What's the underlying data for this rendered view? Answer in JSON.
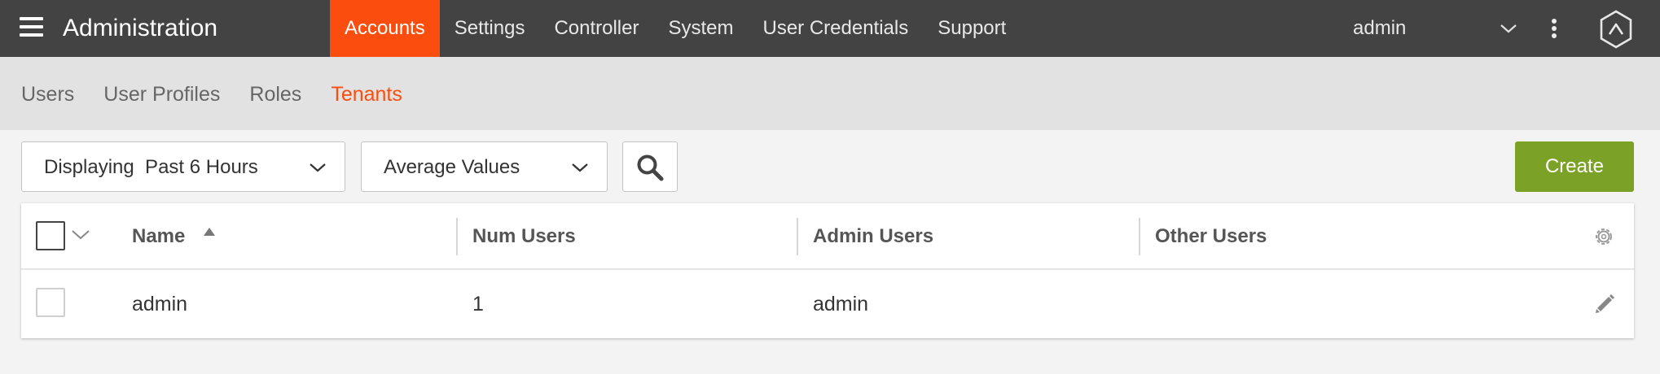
{
  "app": {
    "title": "Administration"
  },
  "top_nav": [
    {
      "label": "Accounts",
      "active": true
    },
    {
      "label": "Settings",
      "active": false
    },
    {
      "label": "Controller",
      "active": false
    },
    {
      "label": "System",
      "active": false
    },
    {
      "label": "User Credentials",
      "active": false
    },
    {
      "label": "Support",
      "active": false
    }
  ],
  "user": {
    "name": "admin"
  },
  "sub_nav": [
    {
      "label": "Users",
      "active": false
    },
    {
      "label": "User Profiles",
      "active": false
    },
    {
      "label": "Roles",
      "active": false
    },
    {
      "label": "Tenants",
      "active": true
    }
  ],
  "toolbar": {
    "time_range": "Displaying  Past 6 Hours",
    "values_mode": "Average Values",
    "create_label": "Create"
  },
  "table": {
    "columns": [
      "Name",
      "Num Users",
      "Admin Users",
      "Other Users"
    ],
    "sort": {
      "column": "Name",
      "direction": "ascending"
    },
    "rows": [
      {
        "name": "admin",
        "num_users": "1",
        "admin_users": "admin",
        "other_users": ""
      }
    ]
  },
  "colors": {
    "topbar": "#434343",
    "accent": "#fa4d0e",
    "create_button": "#7ba127",
    "subbar": "#e2e2e2"
  },
  "icons": [
    "hamburger-icon",
    "chevron-down-icon",
    "kebab-menu-icon",
    "brand-logo",
    "search-icon",
    "sort-asc-icon",
    "gear-icon",
    "pencil-icon"
  ]
}
